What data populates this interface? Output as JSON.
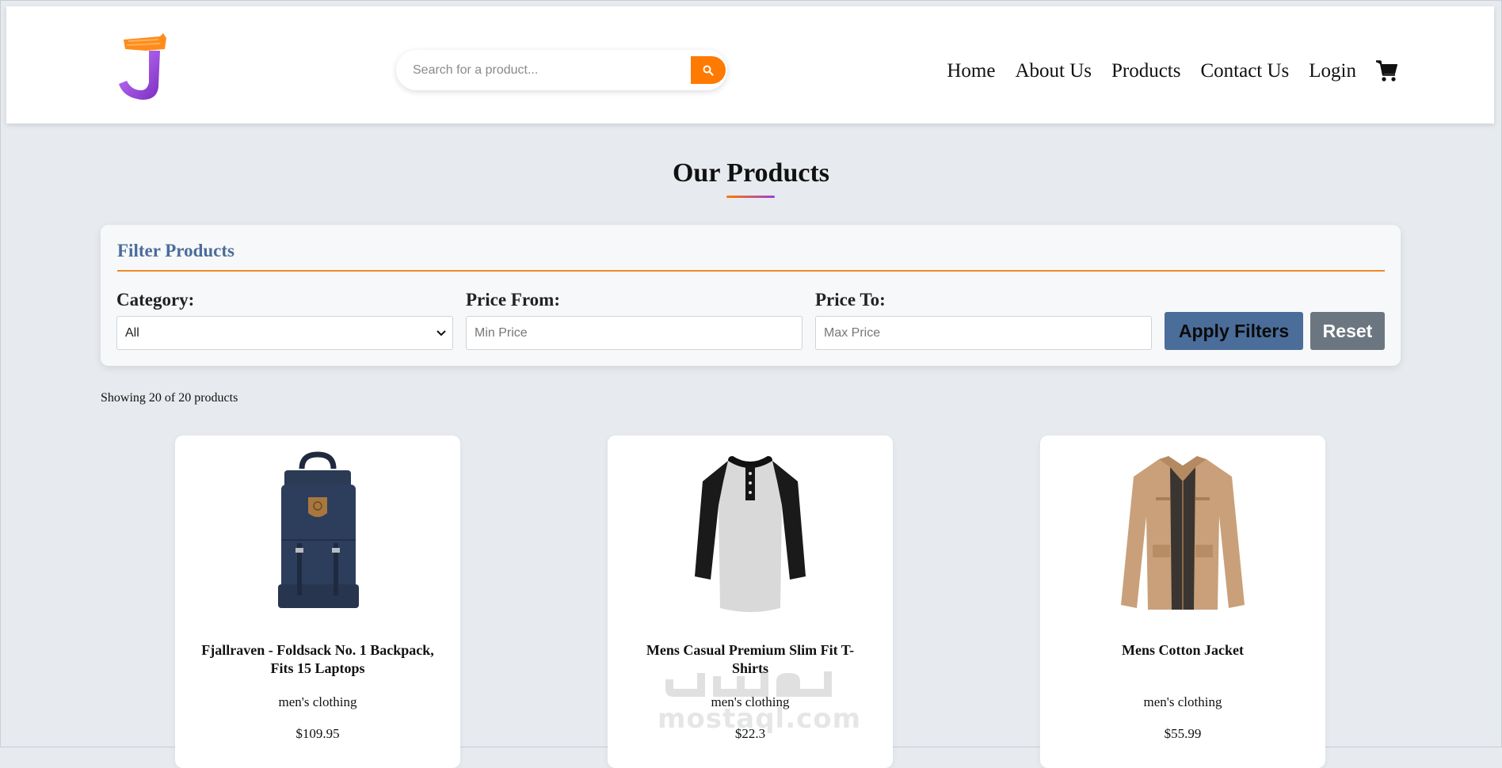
{
  "header": {
    "search": {
      "placeholder": "Search for a product...",
      "value": ""
    },
    "nav": [
      {
        "label": "Home"
      },
      {
        "label": "About Us"
      },
      {
        "label": "Products"
      },
      {
        "label": "Contact Us"
      },
      {
        "label": "Login"
      }
    ],
    "icons": {
      "search": "search-icon",
      "cart": "cart-icon"
    }
  },
  "main": {
    "title": "Our Products",
    "filter": {
      "title": "Filter Products",
      "category_label": "Category:",
      "category_value": "All",
      "price_from_label": "Price From:",
      "price_from_placeholder": "Min Price",
      "price_to_label": "Price To:",
      "price_to_placeholder": "Max Price",
      "apply_label": "Apply Filters",
      "reset_label": "Reset"
    },
    "showing": "Showing 20 of 20 products",
    "products": [
      {
        "name": "Fjallraven - Foldsack No. 1 Backpack, Fits 15 Laptops",
        "category": "men's clothing",
        "price": "$109.95",
        "image": "backpack"
      },
      {
        "name": "Mens Casual Premium Slim Fit T-Shirts",
        "category": "men's clothing",
        "price": "$22.3",
        "image": "raglan-shirt"
      },
      {
        "name": "Mens Cotton Jacket",
        "category": "men's clothing",
        "price": "$55.99",
        "image": "jacket"
      }
    ]
  },
  "watermark": {
    "text": "mostaql.com"
  },
  "colors": {
    "accent_orange": "#ff7a00",
    "accent_purple": "#9b3fd6",
    "filter_blue": "#4a6d9a",
    "reset_gray": "#6c7680",
    "background": "#e7eaee"
  }
}
